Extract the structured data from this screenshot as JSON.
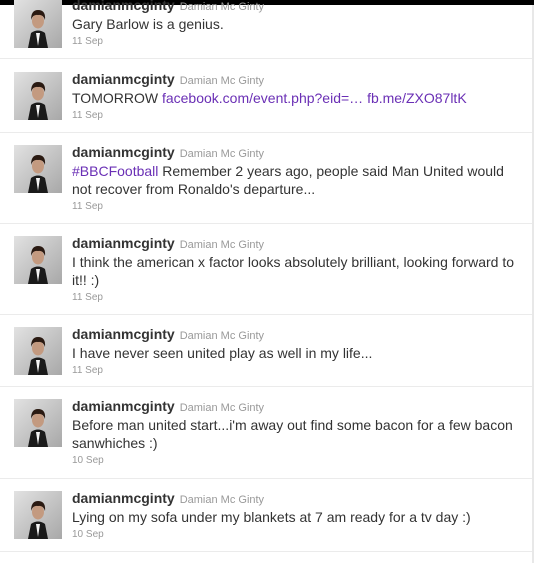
{
  "tweets": [
    {
      "username": "damianmcginty",
      "fullname": "Damian Mc Ginty",
      "text": "Gary Barlow is a genius.",
      "time": "11 Sep"
    },
    {
      "username": "damianmcginty",
      "fullname": "Damian Mc Ginty",
      "text_prefix": "TOMORROW ",
      "link1": "facebook.com/event.php?eid=…",
      "link2": "fb.me/ZXO87ltK",
      "time": "11 Sep"
    },
    {
      "username": "damianmcginty",
      "fullname": "Damian Mc Ginty",
      "hashtag": "#BBCFootball",
      "text": " Remember 2 years ago, people said Man United would not recover from Ronaldo's departure...",
      "time": "11 Sep"
    },
    {
      "username": "damianmcginty",
      "fullname": "Damian Mc Ginty",
      "text": "I think the american x factor looks absolutely brilliant, looking forward to it!! :)",
      "time": "11 Sep"
    },
    {
      "username": "damianmcginty",
      "fullname": "Damian Mc Ginty",
      "text": "I have never seen united play as well in my life...",
      "time": "11 Sep"
    },
    {
      "username": "damianmcginty",
      "fullname": "Damian Mc Ginty",
      "text": "Before man united start...i'm away out find some bacon for a few bacon sanwhiches :)",
      "time": "10 Sep"
    },
    {
      "username": "damianmcginty",
      "fullname": "Damian Mc Ginty",
      "text": "Lying on my sofa under my blankets at 7 am ready for a tv day :)",
      "time": "10 Sep"
    }
  ]
}
